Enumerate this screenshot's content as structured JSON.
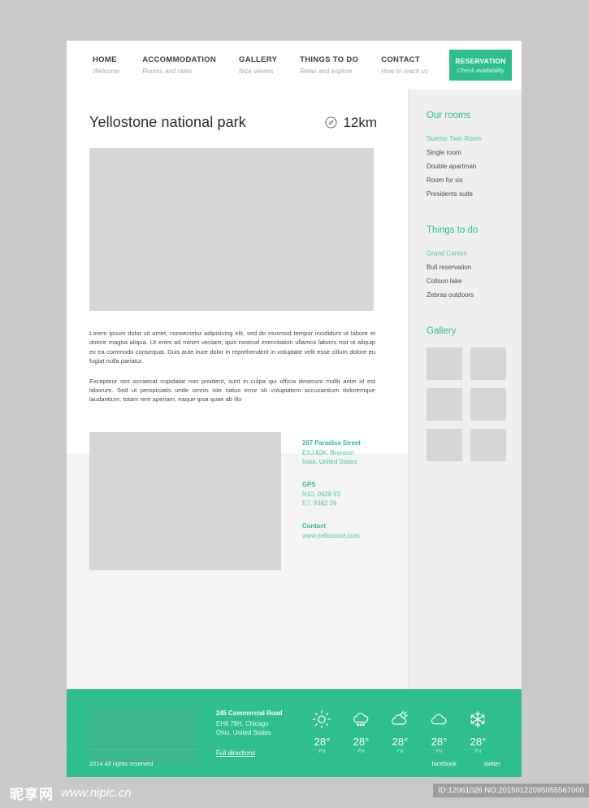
{
  "nav": {
    "items": [
      {
        "title": "HOME",
        "sub": "Welcome"
      },
      {
        "title": "ACCOMMODATION",
        "sub": "Rooms and rates"
      },
      {
        "title": "GALLERY",
        "sub": "Nice viewes"
      },
      {
        "title": "THINGS TO DO",
        "sub": "Relax and explore"
      },
      {
        "title": "CONTACT",
        "sub": "How to reach us"
      }
    ],
    "cta": {
      "title": "RESERVATION",
      "sub": "Check availability"
    }
  },
  "header": {
    "title": "Yellostone national park",
    "distance": "12km",
    "distance_icon": "compass-icon"
  },
  "content": {
    "paragraph1": "Lorem ipsum dolor sit amet, consectetur adipisicing elit, sed do eiusmod tempor incididunt ut labore et dolore magna aliqua. Ut enim ad minim veniam, quis nostrud exercitation ullamco laboris nisi ut aliquip ex ea commodo consequat. Duis aute irure dolor in reprehenderit in voluptate velit esse cillum dolore eu fugiat nulla pariatur.",
    "paragraph2": "Excepteur sint occaecat cupidatat non proident, sunt in culpa qui officia deserunt mollit anim id est laborum. Sed ut perspiciatis unde omnis iste natus error sit voluptatem accusantium doloremque laudantium, totam rem aperiam, eaque ipsa quae ab illo"
  },
  "contact": {
    "street": "287 Paradise Street",
    "line2": "EXJ 83K, Bronson",
    "line3": "Iowa, United States",
    "gps_label": "GPS",
    "gps_lat": "N10, 0928 93",
    "gps_lon": "E7, 9382 29",
    "contact_label": "Contact",
    "website": "www.yellostone.com"
  },
  "sidebar": {
    "rooms_title": "Our rooms",
    "rooms": [
      "Suerior Twin Room",
      "Single room",
      "Double apartman",
      "Room for six",
      "Presidents suite"
    ],
    "things_title": "Things to do",
    "things": [
      "Grand Canion",
      "Bull reservation",
      "Collson lake",
      "Zebras outdoors"
    ],
    "gallery_title": "Gallery",
    "gallery_count": 6
  },
  "footer": {
    "address": {
      "street": "245 Commercial Road",
      "line2": "EH6 78H, Chicago",
      "line3": "Ohio, United States",
      "link": "Full directions"
    },
    "weather": [
      {
        "icon": "sun-icon",
        "temp": "28°",
        "day": "Fri"
      },
      {
        "icon": "rain-cloud-icon",
        "temp": "28°",
        "day": "Fri"
      },
      {
        "icon": "partly-cloudy-icon",
        "temp": "28°",
        "day": "Fri"
      },
      {
        "icon": "cloud-icon",
        "temp": "28°",
        "day": "Fri"
      },
      {
        "icon": "snowflake-icon",
        "temp": "28°",
        "day": "Fri"
      }
    ],
    "copyright": "2014 All rights reserved",
    "social": [
      "facebook",
      "twitter"
    ]
  },
  "watermark": {
    "logo": "昵享网",
    "url": "www.nipic.cn",
    "id": "ID:12061026 NO:20150122095055567000"
  },
  "colors": {
    "brand_green": "#2fbe8f",
    "link_green": "#4fc79c",
    "placeholder_gray": "#d6d6d6"
  }
}
